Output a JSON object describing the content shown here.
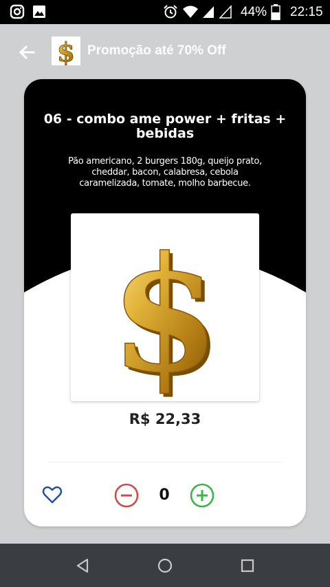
{
  "status_bar": {
    "icons_left": [
      "instagram-icon",
      "image-icon"
    ],
    "icons_right": [
      "alarm-icon",
      "wifi-icon",
      "signal-icon",
      "signal-empty-icon",
      "battery-icon"
    ],
    "battery": "44%",
    "time": "22:15"
  },
  "header": {
    "title": "Promoção até 70% Off",
    "back_icon": "arrow-left-icon",
    "logo_icon": "dollar-icon"
  },
  "product": {
    "title": "06 - combo ame power + fritas + bebidas",
    "description": "Pão americano, 2 burgers 180g, queijo prato, cheddar, bacon, calabresa, cebola caramelizada, tomate, molho barbecue.",
    "price": "R$ 22,33",
    "image_icon": "gold-dollar-icon",
    "quantity": "0"
  },
  "actions": {
    "favorite_icon": "heart-outline-icon",
    "decrement_icon": "minus-circle-icon",
    "increment_icon": "plus-circle-icon"
  },
  "colors": {
    "header_bg": "#cfd0d2",
    "card_top": "#000000",
    "favorite": "#1f4fa0",
    "decrement": "#d34a4a",
    "increment": "#3bb54a",
    "nav_bar": "#3a3d42"
  },
  "nav_bar": {
    "buttons": [
      "back-triangle-icon",
      "home-circle-icon",
      "recents-square-icon"
    ]
  }
}
